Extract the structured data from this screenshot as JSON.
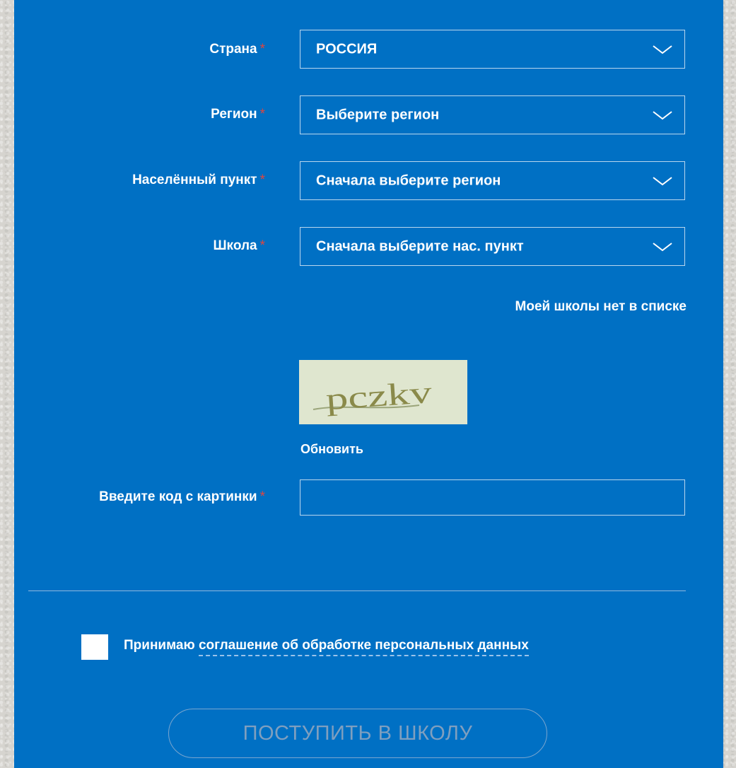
{
  "form": {
    "required_mark": "*",
    "country": {
      "label": "Страна",
      "value": "РОССИЯ"
    },
    "region": {
      "label": "Регион",
      "value": "Выберите регион"
    },
    "locality": {
      "label": "Населённый пункт",
      "value": "Сначала выберите регион"
    },
    "school": {
      "label": "Школа",
      "value": "Сначала выберите нас. пункт"
    },
    "school_missing_link": "Моей школы нет в списке",
    "captcha": {
      "image_text": "pczkv",
      "refresh_label": "Обновить",
      "input_label": "Введите код с картинки",
      "input_value": "",
      "input_placeholder": ""
    },
    "consent": {
      "prefix": "Принимаю",
      "link_text": "соглашение об обработке персональных данных",
      "checked": false
    },
    "submit_label": "ПОСТУПИТЬ В ШКОЛУ"
  },
  "icons": {
    "dropdown": "chevron-down-icon"
  },
  "colors": {
    "panel_background": "#0070c4",
    "required_mark": "#e0453e",
    "text": "#ffffff",
    "page_background": "#d6d4cf",
    "disabled_button_text": "#7f9fbf"
  }
}
